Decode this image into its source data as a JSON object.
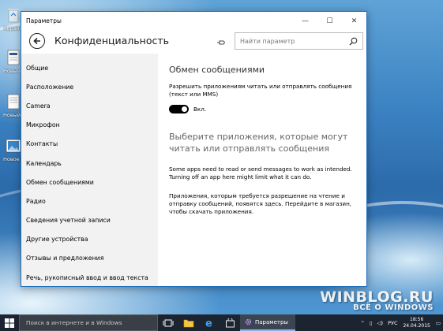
{
  "desktop": {
    "icons": [
      {
        "label": "Корзина"
      },
      {
        "label": "Новый документ"
      },
      {
        "label": "Новый текстовый"
      },
      {
        "label": "Новое изображение"
      }
    ],
    "watermark": {
      "line1": "WINBLOG.RU",
      "line2": "ВСЁ О WINDOWS"
    }
  },
  "window": {
    "title": "Параметры",
    "controls": {
      "minimize": "—",
      "maximize": "☐",
      "close": "✕"
    },
    "page_title": "Конфиденциальность",
    "search": {
      "placeholder": "Найти параметр",
      "value": ""
    }
  },
  "sidebar": {
    "items": [
      {
        "label": "Общие"
      },
      {
        "label": "Расположение"
      },
      {
        "label": "Camera"
      },
      {
        "label": "Микрофон"
      },
      {
        "label": "Контакты"
      },
      {
        "label": "Календарь"
      },
      {
        "label": "Обмен сообщениями"
      },
      {
        "label": "Радио"
      },
      {
        "label": "Сведения учетной записи"
      },
      {
        "label": "Другие устройства"
      },
      {
        "label": "Отзывы и предложения"
      },
      {
        "label": "Речь, рукописный ввод и ввод текста"
      }
    ]
  },
  "content": {
    "section1_title": "Обмен сообщениями",
    "section1_desc": "Разрешить приложениям читать или отправлять сообщения (текст или MMS)",
    "toggle": {
      "state": "on",
      "label": "Вкл."
    },
    "section2_title": "Выберите приложения, которые могут читать или отправлять сообщения",
    "para1": "Some apps need to read or send messages to work as intended. Turning off an app here might limit what it can do.",
    "para2": "Приложения, которым требуется разрешение на чтение и отправку сообщений, появятся здесь. Перейдите в магазин, чтобы скачать приложения."
  },
  "taskbar": {
    "search_placeholder": "Поиск в интернете и в Windows",
    "active_app": "Параметры",
    "tray": {
      "lang": "РУС",
      "time": "18:56",
      "date": "24.04.2015"
    }
  },
  "colors": {
    "accent": "#1d6fb9",
    "taskbar": "#1c2430",
    "sidebar": "#f2f2f2"
  }
}
